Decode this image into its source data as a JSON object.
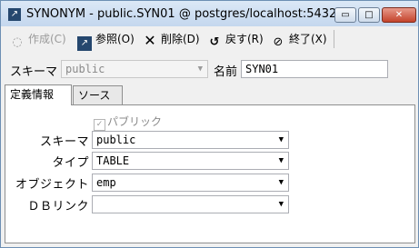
{
  "window": {
    "title": "SYNONYM - public.SYN01 @ postgres/localhost:5432",
    "app_icon": "arrow-icon",
    "minimize": "▭",
    "maximize": "□",
    "close": "✕"
  },
  "toolbar": {
    "create": "作成(C)",
    "reference": "参照(O)",
    "delete": "削除(D)",
    "back": "戻す(R)",
    "exit": "終了(X)"
  },
  "header": {
    "schema_label": "スキーマ",
    "schema_value": "public",
    "name_label": "名前",
    "name_value": "SYN01"
  },
  "tabs": [
    "定義情報",
    "ソース"
  ],
  "form": {
    "public_label": "パブリック",
    "public_checked": true,
    "schema_label": "スキーマ",
    "schema_value": "public",
    "type_label": "タイプ",
    "type_value": "TABLE",
    "object_label": "オブジェクト",
    "object_value": "emp",
    "dblink_label": "ＤＢリンク",
    "dblink_value": ""
  }
}
